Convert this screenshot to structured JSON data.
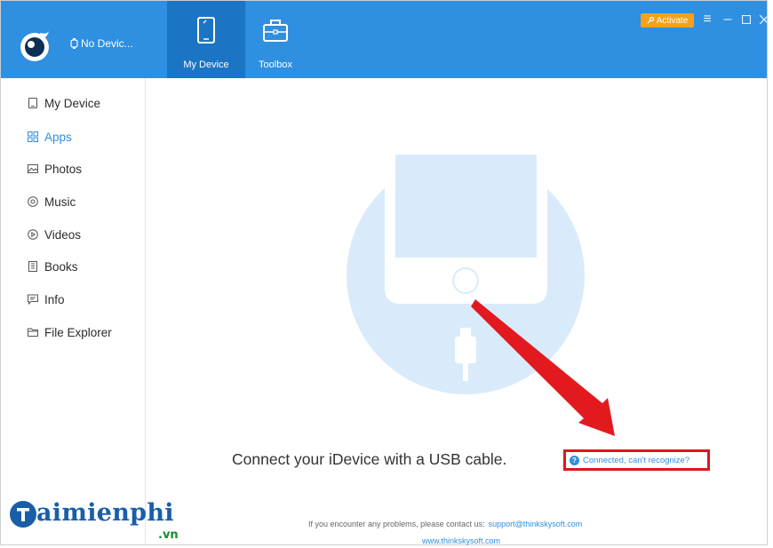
{
  "window": {
    "device_name": "No Devic...",
    "accent_color": "#2f8fe0"
  },
  "nav": {
    "tabs": [
      {
        "label": "My Device",
        "icon": "tablet-icon",
        "active": true
      },
      {
        "label": "Toolbox",
        "icon": "toolbox-icon",
        "active": false
      }
    ]
  },
  "titlebar": {
    "activate_label": "Activate",
    "controls": [
      "menu-icon",
      "minimize-icon",
      "maximize-icon",
      "close-icon"
    ]
  },
  "sidebar": {
    "items": [
      {
        "label": "My Device",
        "icon": "device-icon",
        "active": false
      },
      {
        "label": "Apps",
        "icon": "apps-grid-icon",
        "active": true
      },
      {
        "label": "Photos",
        "icon": "photo-icon",
        "active": false
      },
      {
        "label": "Music",
        "icon": "music-icon",
        "active": false
      },
      {
        "label": "Videos",
        "icon": "video-icon",
        "active": false
      },
      {
        "label": "Books",
        "icon": "book-icon",
        "active": false
      },
      {
        "label": "Info",
        "icon": "message-icon",
        "active": false
      },
      {
        "label": "File Explorer",
        "icon": "folder-icon",
        "active": false
      }
    ]
  },
  "main": {
    "connect_message": "Connect your iDevice with a USB cable.",
    "help_link": "Connected, can't recognize?",
    "contact_text": "If you encounter any problems, please contact us:",
    "contact_email": "support@thinkskysoft.com",
    "website": "www.thinkskysoft.com"
  },
  "watermark": {
    "text": "aimienphi",
    "suffix": ".vn"
  }
}
